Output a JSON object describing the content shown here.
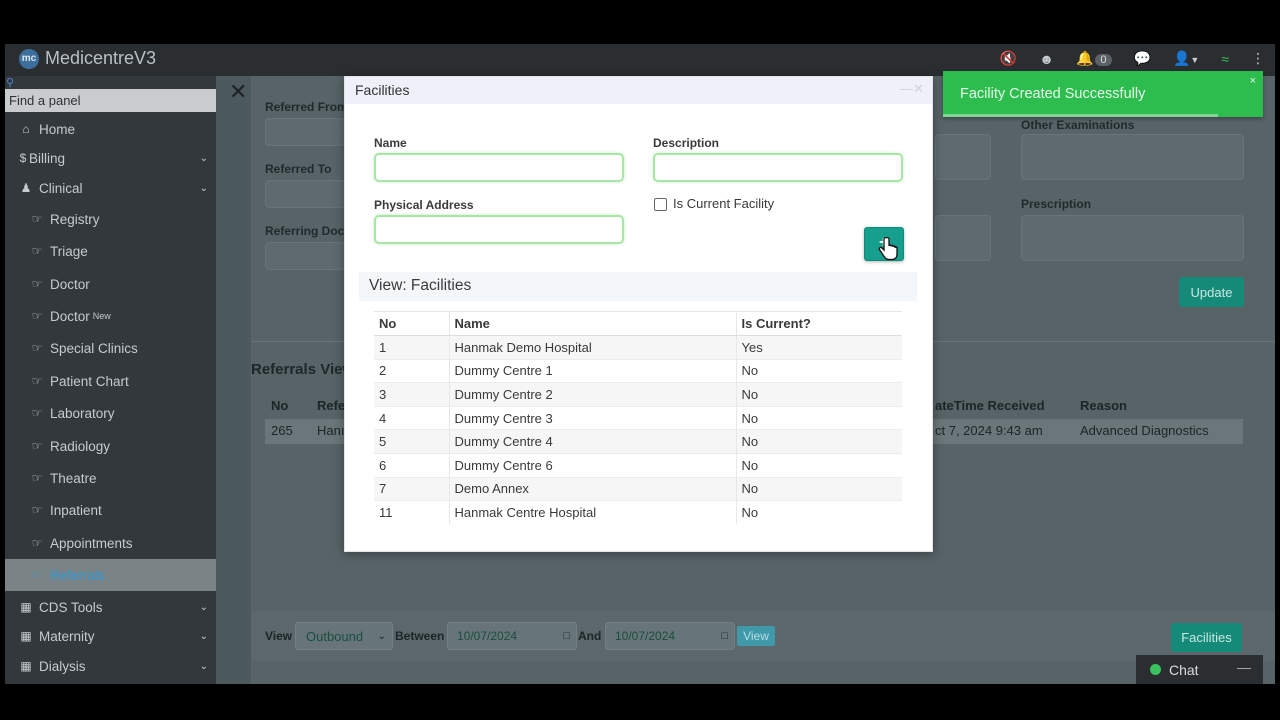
{
  "app": {
    "title": "MedicentreV3",
    "logo_text": "mc"
  },
  "topbar": {
    "notification_count": "0"
  },
  "sidebar": {
    "search_placeholder": "Find a panel",
    "items": [
      {
        "label": "Home",
        "icon": "home-icon"
      },
      {
        "label": "Billing",
        "icon": "dollar-icon"
      },
      {
        "label": "Clinical",
        "icon": "user-icon"
      },
      {
        "label": "Registry",
        "icon": "hand-icon"
      },
      {
        "label": "Triage",
        "icon": "hand-icon"
      },
      {
        "label": "Doctor",
        "icon": "hand-icon"
      },
      {
        "label": "Doctor",
        "icon": "hand-icon",
        "tag": "New"
      },
      {
        "label": "Special Clinics",
        "icon": "hand-icon"
      },
      {
        "label": "Patient Chart",
        "icon": "hand-icon"
      },
      {
        "label": "Laboratory",
        "icon": "hand-icon"
      },
      {
        "label": "Radiology",
        "icon": "hand-icon"
      },
      {
        "label": "Theatre",
        "icon": "hand-icon"
      },
      {
        "label": "Inpatient",
        "icon": "hand-icon"
      },
      {
        "label": "Appointments",
        "icon": "hand-icon"
      },
      {
        "label": "Referrals",
        "icon": "hand-icon"
      },
      {
        "label": "CDS Tools",
        "icon": "grid-icon"
      },
      {
        "label": "Maternity",
        "icon": "grid-icon"
      },
      {
        "label": "Dialysis",
        "icon": "grid-icon"
      }
    ]
  },
  "background": {
    "referred_from_label": "Referred From",
    "referred_to_label": "Referred To",
    "referring_doctor_label": "Referring Docto",
    "other_examinations_label": "Other Examinations",
    "prescription_label": "Prescription",
    "update_label": "Update",
    "referrals_view_title": "Referrals View",
    "table_headers": {
      "no": "No",
      "ref": "Refe",
      "datetime": "ateTime Received",
      "reason": "Reason"
    },
    "row": {
      "no": "265",
      "ref": "Hanı",
      "datetime": "ct 7, 2024 9:43 am",
      "reason": "Advanced Diagnostics"
    },
    "footer": {
      "view_label": "View",
      "view_select": "Outbound",
      "between_label": "Between",
      "date_from": "10/07/2024",
      "and_label": "And",
      "date_to": "10/07/2024",
      "view_button": "View",
      "facilities_button": "Facilities"
    }
  },
  "modal": {
    "title": "Facilities",
    "name_label": "Name",
    "description_label": "Description",
    "address_label": "Physical Address",
    "current_label": "Is Current Facility",
    "view_title": "View: Facilities",
    "table": {
      "headers": {
        "no": "No",
        "name": "Name",
        "current": "Is Current?"
      },
      "rows": [
        {
          "no": "1",
          "name": "Hanmak Demo Hospital",
          "current": "Yes"
        },
        {
          "no": "2",
          "name": "Dummy Centre 1",
          "current": "No"
        },
        {
          "no": "3",
          "name": "Dummy Centre 2",
          "current": "No"
        },
        {
          "no": "4",
          "name": "Dummy Centre 3",
          "current": "No"
        },
        {
          "no": "5",
          "name": "Dummy Centre 4",
          "current": "No"
        },
        {
          "no": "6",
          "name": "Dummy Centre 6",
          "current": "No"
        },
        {
          "no": "7",
          "name": "Demo Annex",
          "current": "No"
        },
        {
          "no": "11",
          "name": "Hanmak Centre Hospital",
          "current": "No"
        }
      ]
    }
  },
  "toast": {
    "message": "Facility Created Successfully",
    "close": "×"
  },
  "chat": {
    "label": "Chat",
    "minimize": "—"
  },
  "colors": {
    "accent": "#169f8c",
    "toast": "#2dbd4f",
    "sidebar": "#32383b",
    "active_item": "#2f9ad3"
  }
}
